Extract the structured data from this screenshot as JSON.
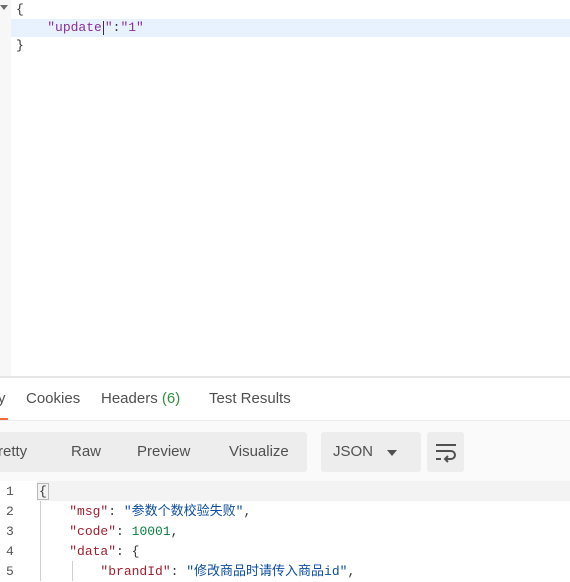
{
  "request_body": {
    "lines": [
      "{",
      "    \"update\":\"1\"",
      "}"
    ],
    "key": "\"update",
    "key_tail": "\"",
    "colon": ":",
    "value": "\"1\""
  },
  "response_tabs": {
    "partial_left": "y",
    "items": [
      {
        "label": "Cookies"
      },
      {
        "label": "Headers",
        "count": "(6)"
      },
      {
        "label": "Test Results"
      }
    ]
  },
  "view_modes": {
    "pretty": "Pretty",
    "raw": "Raw",
    "preview": "Preview",
    "visualize": "Visualize"
  },
  "format_select": {
    "value": "JSON"
  },
  "wrap_button": {
    "icon": "wrap-lines-icon"
  },
  "response_body": {
    "line_numbers": [
      "1",
      "2",
      "3",
      "4",
      "5"
    ],
    "open_brace": "{",
    "msg_key": "\"msg\"",
    "msg_value": "\"参数个数校验失败\"",
    "code_key": "\"code\"",
    "code_value": "10001",
    "data_key": "\"data\"",
    "data_open": "{",
    "brand_key": "\"brandId\"",
    "brand_value": "\"修改商品时请传入商品id\""
  },
  "colors": {
    "accent": "#f26b3a",
    "count_green": "#2f8f3a",
    "json_key": "#a11e2e",
    "json_string": "#0b4ea2",
    "json_number": "#0a7f3f"
  }
}
